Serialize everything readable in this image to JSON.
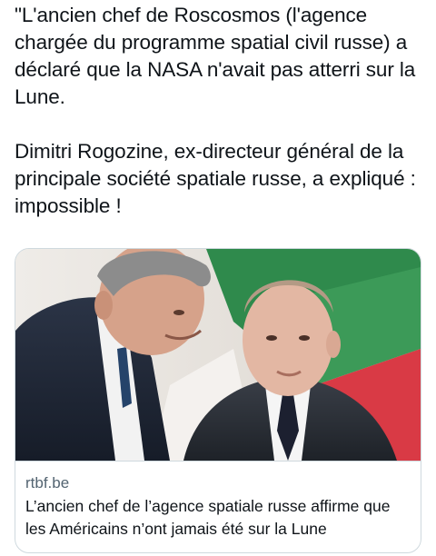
{
  "tweet": {
    "paragraph_1": "\"L'ancien chef de Roscosmos (l'agence chargée du programme spatial civil russe) a déclaré que la NASA n'avait pas atterri sur la Lune.",
    "paragraph_2": "Dimitri Rogozine, ex-directeur général de la principale société spatiale russe, a expliqué : impossible !"
  },
  "link_card": {
    "domain": "rtbf.be",
    "title": "L’ancien chef de l’agence spatiale russe affirme que les Américains n’ont jamais été sur la Lune"
  },
  "colors": {
    "text": "#0f1419",
    "secondary_text": "#536471",
    "border": "#cfd9de",
    "backdrop_green": "#2f8a4c",
    "backdrop_red": "#d93a45"
  }
}
